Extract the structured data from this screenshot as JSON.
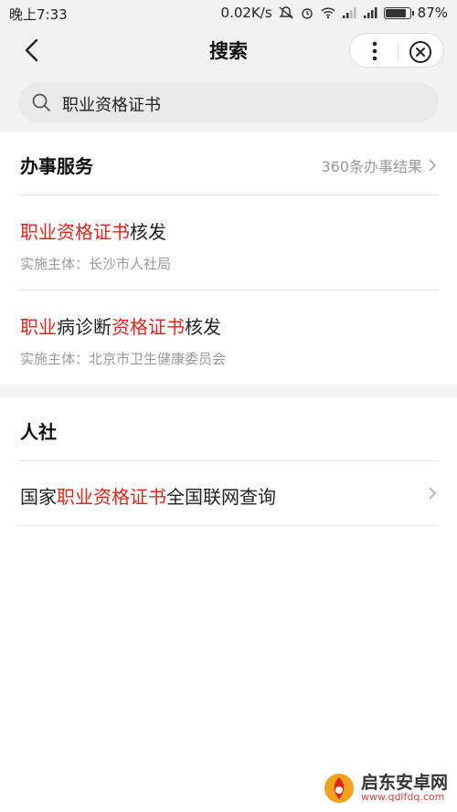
{
  "status_bar": {
    "time": "晚上7:33",
    "speed": "0.02K/s",
    "battery": "87%"
  },
  "nav": {
    "title": "搜索"
  },
  "search": {
    "query": "职业资格证书"
  },
  "section_services": {
    "title": "办事服务",
    "more": "360条办事结果",
    "items": [
      {
        "name_parts": [
          "职业资格证书",
          "核发"
        ],
        "sub": "实施主体：长沙市人社局"
      },
      {
        "name_parts": [
          "职业",
          "病诊断",
          "资格证书",
          "核发"
        ],
        "sub": "实施主体：北京市卫生健康委员会"
      }
    ]
  },
  "section_hr": {
    "title": "人社",
    "items": [
      {
        "name_parts": [
          "国家",
          "职业资格证书",
          "全国联网查询"
        ]
      }
    ]
  },
  "watermark": {
    "brand": "启东安卓网",
    "url": "www.qdlfdq.com"
  },
  "colors": {
    "highlight": "#e0241c",
    "muted": "#9a9a9a",
    "band": "#f2f2f2"
  }
}
